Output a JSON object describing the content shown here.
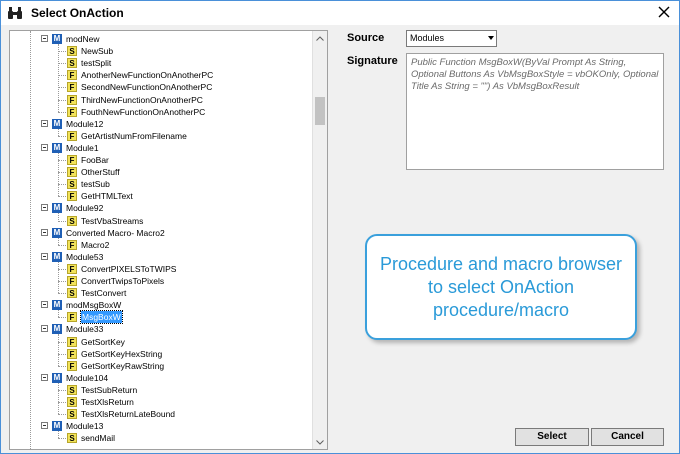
{
  "window": {
    "title": "Select OnAction",
    "app_icon": "binoculars-icon",
    "close_icon": "close-icon"
  },
  "tree": {
    "nodes": [
      {
        "type": "M",
        "label": "modNew"
      },
      {
        "type": "S",
        "label": "NewSub"
      },
      {
        "type": "S",
        "label": "testSplit"
      },
      {
        "type": "F",
        "label": "AnotherNewFunctionOnAnotherPC"
      },
      {
        "type": "F",
        "label": "SecondNewFunctionOnAnotherPC"
      },
      {
        "type": "F",
        "label": "ThirdNewFunctionOnAnotherPC"
      },
      {
        "type": "F",
        "label": "FouthNewFunctionOnAnotherPC"
      },
      {
        "type": "M",
        "label": "Module12"
      },
      {
        "type": "F",
        "label": "GetArtistNumFromFilename"
      },
      {
        "type": "M",
        "label": "Module1"
      },
      {
        "type": "F",
        "label": "FooBar"
      },
      {
        "type": "F",
        "label": "OtherStuff"
      },
      {
        "type": "S",
        "label": "testSub"
      },
      {
        "type": "F",
        "label": "GetHTMLText"
      },
      {
        "type": "M",
        "label": "Module92"
      },
      {
        "type": "S",
        "label": "TestVbaStreams"
      },
      {
        "type": "M",
        "label": "Converted Macro- Macro2"
      },
      {
        "type": "F",
        "label": "Macro2"
      },
      {
        "type": "M",
        "label": "Module53"
      },
      {
        "type": "F",
        "label": "ConvertPIXELSToTWIPS"
      },
      {
        "type": "F",
        "label": "ConvertTwipsToPixels"
      },
      {
        "type": "S",
        "label": "TestConvert"
      },
      {
        "type": "M",
        "label": "modMsgBoxW"
      },
      {
        "type": "F",
        "label": "MsgBoxW",
        "selected": true
      },
      {
        "type": "M",
        "label": "Module33"
      },
      {
        "type": "F",
        "label": "GetSortKey"
      },
      {
        "type": "F",
        "label": "GetSortKeyHexString"
      },
      {
        "type": "F",
        "label": "GetSortKeyRawString"
      },
      {
        "type": "M",
        "label": "Module104"
      },
      {
        "type": "S",
        "label": "TestSubReturn"
      },
      {
        "type": "S",
        "label": "TestXlsReturn"
      },
      {
        "type": "S",
        "label": "TestXlsReturnLateBound"
      },
      {
        "type": "M",
        "label": "Module13"
      },
      {
        "type": "S",
        "label": "sendMail"
      }
    ],
    "expander_symbol": "−"
  },
  "source": {
    "label": "Source",
    "value": "Modules"
  },
  "signature": {
    "label": "Signature",
    "text": "Public Function MsgBoxW(ByVal Prompt As String, Optional Buttons As VbMsgBoxStyle = vbOKOnly, Optional Title As String = \"\") As VbMsgBoxResult"
  },
  "callout": {
    "text": "Procedure and macro browser to select OnAction procedure/macro"
  },
  "buttons": {
    "select": "Select",
    "cancel": "Cancel"
  },
  "colors": {
    "accent": "#2a9ad8",
    "module_badge": "#1f5fb5",
    "proc_badge": "#f2e35a",
    "selection": "#3399ff"
  }
}
